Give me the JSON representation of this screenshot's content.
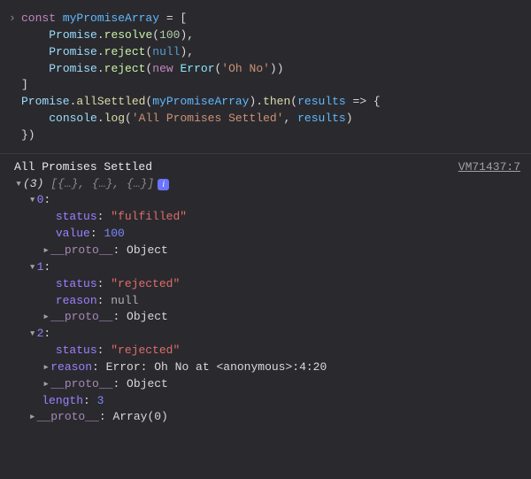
{
  "input": {
    "prompt_glyph": "›",
    "lines": [
      {
        "indent": 0,
        "segments": [
          {
            "t": "const ",
            "c": "tok-kw"
          },
          {
            "t": "myPromiseArray",
            "c": "tok-var"
          },
          {
            "t": " = [",
            "c": "tok-punc"
          }
        ]
      },
      {
        "indent": 1,
        "segments": [
          {
            "t": "Promise",
            "c": "tok-obj"
          },
          {
            "t": ".",
            "c": "tok-punc"
          },
          {
            "t": "resolve",
            "c": "tok-fn"
          },
          {
            "t": "(",
            "c": "tok-punc"
          },
          {
            "t": "100",
            "c": "tok-num"
          },
          {
            "t": "),",
            "c": "tok-punc"
          }
        ]
      },
      {
        "indent": 1,
        "segments": [
          {
            "t": "Promise",
            "c": "tok-obj"
          },
          {
            "t": ".",
            "c": "tok-punc"
          },
          {
            "t": "reject",
            "c": "tok-fn"
          },
          {
            "t": "(",
            "c": "tok-punc"
          },
          {
            "t": "null",
            "c": "tok-null"
          },
          {
            "t": "),",
            "c": "tok-punc"
          }
        ]
      },
      {
        "indent": 1,
        "segments": [
          {
            "t": "Promise",
            "c": "tok-obj"
          },
          {
            "t": ".",
            "c": "tok-punc"
          },
          {
            "t": "reject",
            "c": "tok-fn"
          },
          {
            "t": "(",
            "c": "tok-punc"
          },
          {
            "t": "new ",
            "c": "tok-kw"
          },
          {
            "t": "Error",
            "c": "tok-type"
          },
          {
            "t": "(",
            "c": "tok-punc"
          },
          {
            "t": "'Oh No'",
            "c": "tok-str"
          },
          {
            "t": "))",
            "c": "tok-punc"
          }
        ]
      },
      {
        "indent": 0,
        "segments": [
          {
            "t": "]",
            "c": "tok-punc"
          }
        ]
      },
      {
        "indent": 0,
        "segments": [
          {
            "t": "Promise",
            "c": "tok-obj"
          },
          {
            "t": ".",
            "c": "tok-punc"
          },
          {
            "t": "allSettled",
            "c": "tok-fn2"
          },
          {
            "t": "(",
            "c": "tok-punc"
          },
          {
            "t": "myPromiseArray",
            "c": "tok-var"
          },
          {
            "t": ").",
            "c": "tok-punc"
          },
          {
            "t": "then",
            "c": "tok-fn2"
          },
          {
            "t": "(",
            "c": "tok-punc"
          },
          {
            "t": "results",
            "c": "tok-var"
          },
          {
            "t": " => {",
            "c": "tok-punc"
          }
        ]
      },
      {
        "indent": 1,
        "segments": [
          {
            "t": "console",
            "c": "tok-obj"
          },
          {
            "t": ".",
            "c": "tok-punc"
          },
          {
            "t": "log",
            "c": "tok-fn2"
          },
          {
            "t": "(",
            "c": "tok-punc"
          },
          {
            "t": "'All Promises Settled'",
            "c": "tok-str"
          },
          {
            "t": ", ",
            "c": "tok-punc"
          },
          {
            "t": "results",
            "c": "tok-var"
          },
          {
            "t": ")",
            "c": "tok-punc"
          }
        ]
      },
      {
        "indent": 0,
        "segments": [
          {
            "t": "})",
            "c": "tok-punc"
          }
        ]
      }
    ]
  },
  "output": {
    "message": "All Promises Settled",
    "source_link": "VM71437:7",
    "array_summary": {
      "length_label": "(3)",
      "preview": "[{…}, {…}, {…}]",
      "info_glyph": "i"
    },
    "items": [
      {
        "index": "0",
        "props": [
          {
            "key": "status",
            "val": "\"fulfilled\"",
            "cls": "valstr"
          },
          {
            "key": "value",
            "val": "100",
            "cls": "valnum"
          }
        ],
        "proto": {
          "key": "__proto__",
          "val": "Object"
        }
      },
      {
        "index": "1",
        "props": [
          {
            "key": "status",
            "val": "\"rejected\"",
            "cls": "valstr"
          },
          {
            "key": "reason",
            "val": "null",
            "cls": "valnull"
          }
        ],
        "proto": {
          "key": "__proto__",
          "val": "Object"
        }
      },
      {
        "index": "2",
        "props": [
          {
            "key": "status",
            "val": "\"rejected\"",
            "cls": "valstr"
          },
          {
            "key": "reason",
            "val": "Error: Oh No at <anonymous>:4:20",
            "cls": "valobj",
            "expandable": true
          }
        ],
        "proto": {
          "key": "__proto__",
          "val": "Object"
        }
      }
    ],
    "tail": [
      {
        "key": "length",
        "val": "3",
        "cls": "valnum"
      },
      {
        "key": "__proto__",
        "val": "Array(0)",
        "expandable": true
      }
    ]
  }
}
